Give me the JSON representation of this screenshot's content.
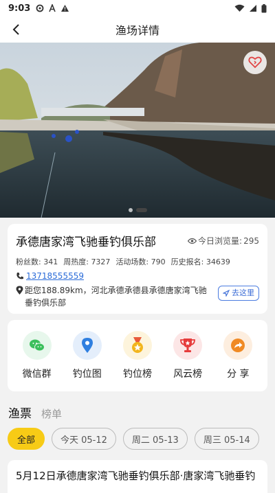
{
  "status_bar": {
    "time": "9:03"
  },
  "app_bar": {
    "title": "渔场详情"
  },
  "hero": {
    "slide_count": 2,
    "active_slide": 2
  },
  "venue": {
    "name": "承德唐家湾飞驰垂钓俱乐部",
    "views_label": "今日浏览量:",
    "views_value": "295",
    "stats": [
      {
        "label": "粉丝数:",
        "value": "341"
      },
      {
        "label": "周热度:",
        "value": "7327"
      },
      {
        "label": "活动场数:",
        "value": "790"
      },
      {
        "label": "历史报名:",
        "value": "34639"
      }
    ],
    "phone": "13718555559",
    "address": "距您188.89km，河北承德承德县承德唐家湾飞驰垂钓俱乐部",
    "go_button": "去这里"
  },
  "actions": [
    {
      "label": "微信群",
      "icon": "wechat-icon",
      "color": "#3cbf5c",
      "bg": "#e7f7ec"
    },
    {
      "label": "钓位图",
      "icon": "location-pin-icon",
      "color": "#2f7fe0",
      "bg": "#e4eefb"
    },
    {
      "label": "钓位榜",
      "icon": "medal-icon",
      "color": "#f2b51c",
      "bg": "#fdf4dc"
    },
    {
      "label": "风云榜",
      "icon": "trophy-icon",
      "color": "#e63b3b",
      "bg": "#fce6e6"
    },
    {
      "label": "分 享",
      "icon": "share-icon",
      "color": "#f08a24",
      "bg": "#fdeedf"
    }
  ],
  "tabs": {
    "tickets": "渔票",
    "ranking": "榜单"
  },
  "date_chips": [
    "全部",
    "今天 05-12",
    "周二 05-13",
    "周三 05-14"
  ],
  "ticket": {
    "title": "5月12日承德唐家湾飞驰垂钓俱乐部·唐家湾飞驰垂钓"
  }
}
